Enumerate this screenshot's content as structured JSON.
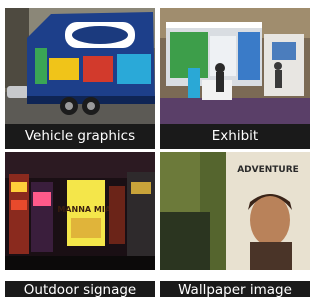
{
  "tiles": [
    {
      "caption": "Vehicle graphics"
    },
    {
      "caption": "Exhibit"
    },
    {
      "caption": "Outdoor signage"
    },
    {
      "caption": "Wallpaper image"
    }
  ],
  "poster_text": {
    "sign": "MANNA MIA!",
    "wallpaper": "ADVENTURE"
  }
}
